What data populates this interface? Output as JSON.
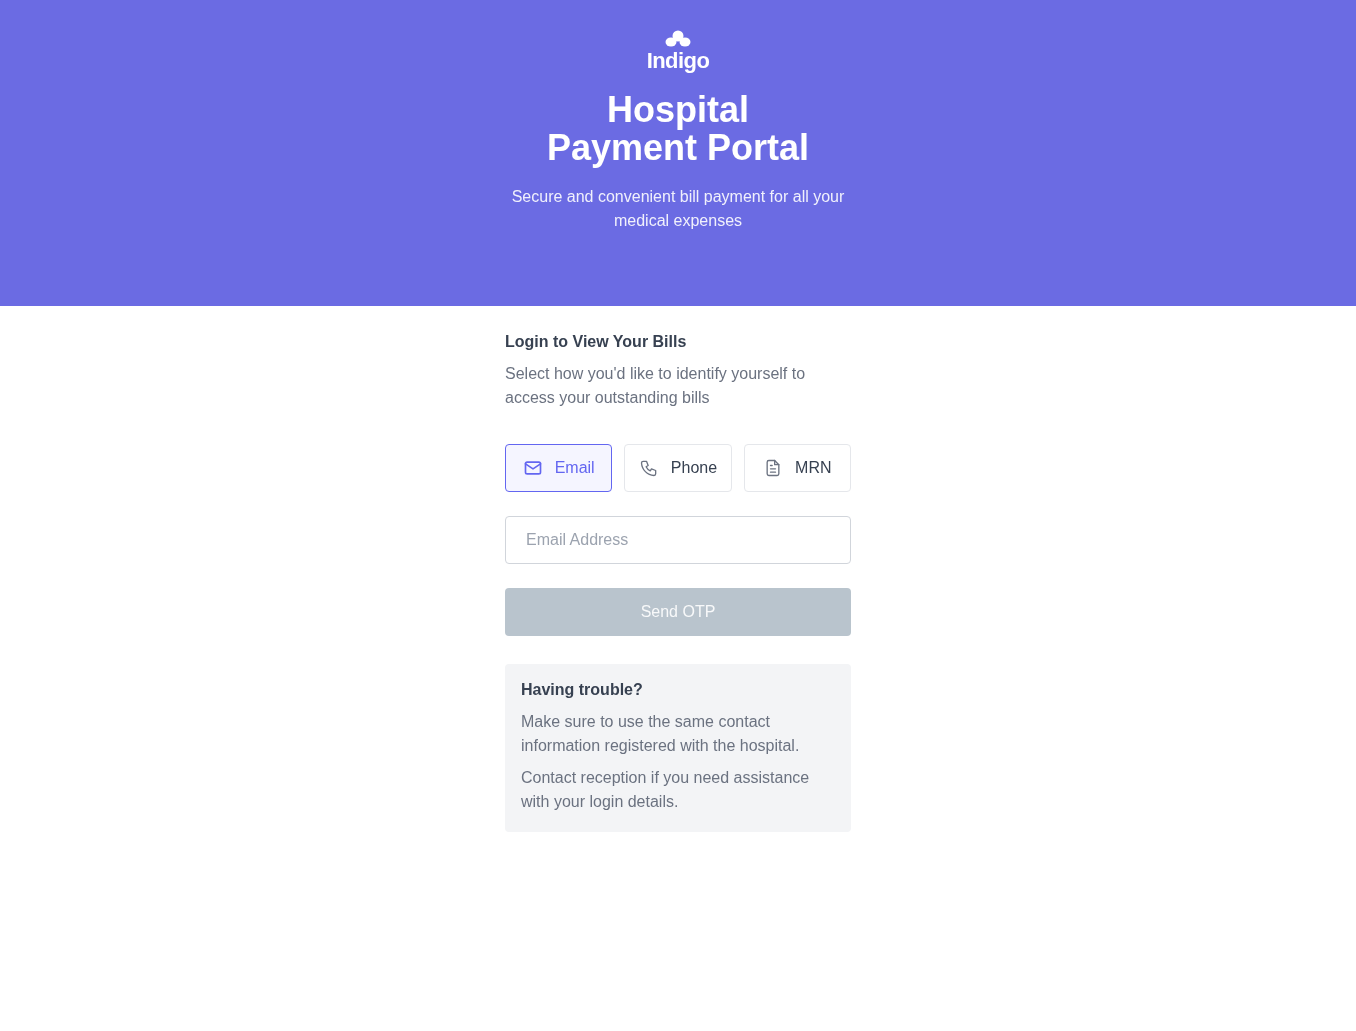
{
  "brand": {
    "name": "Indigo"
  },
  "header": {
    "title_lines": [
      "Hospital",
      "Payment Portal"
    ],
    "subtitle": "Secure and convenient bill payment for all your medical expenses"
  },
  "login": {
    "title": "Login to View Your Bills",
    "description": "Select how you'd like to identify yourself to access your outstanding bills",
    "methods": [
      {
        "kind": "email",
        "label": "Email",
        "selected": true
      },
      {
        "kind": "phone",
        "label": "Phone",
        "selected": false
      },
      {
        "kind": "mrn",
        "label": "MRN",
        "selected": false
      }
    ],
    "field": {
      "placeholder": "Email Address"
    },
    "button": {
      "label": "Send OTP",
      "disabled": true
    }
  },
  "help": {
    "title": "Having trouble?",
    "paragraphs": [
      "Make sure to use the same contact information registered with the hospital.",
      "Contact reception if you need assistance with your login details."
    ]
  }
}
